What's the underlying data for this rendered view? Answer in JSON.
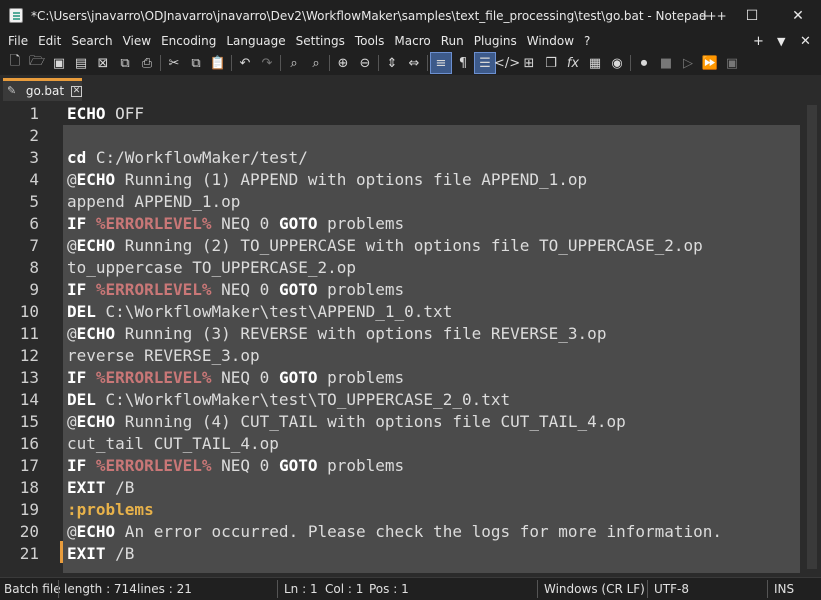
{
  "window": {
    "title": "*C:\\Users\\jnavarro\\ODJnavarro\\jnavarro\\Dev2\\WorkflowMaker\\samples\\text_file_processing\\test\\go.bat - Notepad++",
    "minimize": "—",
    "maximize": "☐",
    "close": "✕"
  },
  "menu": {
    "items": [
      "File",
      "Edit",
      "Search",
      "View",
      "Encoding",
      "Language",
      "Settings",
      "Tools",
      "Macro",
      "Run",
      "Plugins",
      "Window",
      "?"
    ],
    "right_plus": "+",
    "right_down": "▼",
    "right_close": "✕"
  },
  "toolbar": {
    "icons": [
      "new-file-icon",
      "open-file-icon",
      "save-icon",
      "save-all-icon",
      "close-icon",
      "close-all-icon",
      "print-icon",
      "cut-icon",
      "copy-icon",
      "paste-icon",
      "undo-icon",
      "redo-icon",
      "find-icon",
      "replace-icon",
      "zoom-in-icon",
      "zoom-out-icon",
      "sync-vertical-icon",
      "sync-horizontal-icon",
      "word-wrap-icon",
      "all-chars-icon",
      "indent-guide-icon",
      "lang-udl-icon",
      "doc-map-icon",
      "doc-list-icon",
      "function-list-icon",
      "folder-workspace-icon",
      "monitoring-icon",
      "record-macro-icon",
      "stop-macro-icon",
      "play-macro-icon",
      "run-macro-multiple-icon",
      "save-macro-icon"
    ]
  },
  "tab": {
    "label": "go.bat",
    "close": "✕"
  },
  "editor": {
    "line_numbers": [
      "1",
      "2",
      "3",
      "4",
      "5",
      "6",
      "7",
      "8",
      "9",
      "10",
      "11",
      "12",
      "13",
      "14",
      "15",
      "16",
      "17",
      "18",
      "19",
      "20",
      "21"
    ],
    "lines": [
      [
        {
          "t": "ECHO",
          "c": "kw"
        },
        {
          "t": " OFF",
          "c": ""
        }
      ],
      [],
      [
        {
          "t": "cd",
          "c": "kw"
        },
        {
          "t": " C:/WorkflowMaker/test/",
          "c": ""
        }
      ],
      [
        {
          "t": "@",
          "c": ""
        },
        {
          "t": "ECHO",
          "c": "kw"
        },
        {
          "t": " Running (1) APPEND with options file APPEND_1.op",
          "c": ""
        }
      ],
      [
        {
          "t": "append APPEND_1.op",
          "c": ""
        }
      ],
      [
        {
          "t": "IF",
          "c": "kw"
        },
        {
          "t": " ",
          "c": ""
        },
        {
          "t": "%ERRORLEVEL%",
          "c": "var"
        },
        {
          "t": " NEQ 0 ",
          "c": ""
        },
        {
          "t": "GOTO",
          "c": "kw"
        },
        {
          "t": " problems",
          "c": ""
        }
      ],
      [
        {
          "t": "@",
          "c": ""
        },
        {
          "t": "ECHO",
          "c": "kw"
        },
        {
          "t": " Running (2) TO_UPPERCASE with options file TO_UPPERCASE_2.op",
          "c": ""
        }
      ],
      [
        {
          "t": "to_uppercase TO_UPPERCASE_2.op",
          "c": ""
        }
      ],
      [
        {
          "t": "IF",
          "c": "kw"
        },
        {
          "t": " ",
          "c": ""
        },
        {
          "t": "%ERRORLEVEL%",
          "c": "var"
        },
        {
          "t": " NEQ 0 ",
          "c": ""
        },
        {
          "t": "GOTO",
          "c": "kw"
        },
        {
          "t": " problems",
          "c": ""
        }
      ],
      [
        {
          "t": "DEL",
          "c": "kw"
        },
        {
          "t": " C:\\WorkflowMaker\\test\\APPEND_1_0.txt",
          "c": ""
        }
      ],
      [
        {
          "t": "@",
          "c": ""
        },
        {
          "t": "ECHO",
          "c": "kw"
        },
        {
          "t": " Running (3) REVERSE with options file REVERSE_3.op",
          "c": ""
        }
      ],
      [
        {
          "t": "reverse REVERSE_3.op",
          "c": ""
        }
      ],
      [
        {
          "t": "IF",
          "c": "kw"
        },
        {
          "t": " ",
          "c": ""
        },
        {
          "t": "%ERRORLEVEL%",
          "c": "var"
        },
        {
          "t": " NEQ 0 ",
          "c": ""
        },
        {
          "t": "GOTO",
          "c": "kw"
        },
        {
          "t": " problems",
          "c": ""
        }
      ],
      [
        {
          "t": "DEL",
          "c": "kw"
        },
        {
          "t": " C:\\WorkflowMaker\\test\\TO_UPPERCASE_2_0.txt",
          "c": ""
        }
      ],
      [
        {
          "t": "@",
          "c": ""
        },
        {
          "t": "ECHO",
          "c": "kw"
        },
        {
          "t": " Running (4) CUT_TAIL with options file CUT_TAIL_4.op",
          "c": ""
        }
      ],
      [
        {
          "t": "cut_tail CUT_TAIL_4.op",
          "c": ""
        }
      ],
      [
        {
          "t": "IF",
          "c": "kw"
        },
        {
          "t": " ",
          "c": ""
        },
        {
          "t": "%ERRORLEVEL%",
          "c": "var"
        },
        {
          "t": " NEQ 0 ",
          "c": ""
        },
        {
          "t": "GOTO",
          "c": "kw"
        },
        {
          "t": " problems",
          "c": ""
        }
      ],
      [
        {
          "t": "EXIT",
          "c": "kw"
        },
        {
          "t": " /B",
          "c": ""
        }
      ],
      [
        {
          "t": ":problems",
          "c": "lbl"
        }
      ],
      [
        {
          "t": "@",
          "c": ""
        },
        {
          "t": "ECHO",
          "c": "kw"
        },
        {
          "t": " An error occurred. Please check the logs for more information.",
          "c": ""
        }
      ],
      [
        {
          "t": "EXIT",
          "c": "kw"
        },
        {
          "t": " /B",
          "c": ""
        }
      ]
    ]
  },
  "status": {
    "file_type": "Batch file",
    "length": "length : 714",
    "lines": "lines : 21",
    "ln": "Ln : 1",
    "col": "Col : 1",
    "pos": "Pos : 1",
    "eol": "Windows (CR LF)",
    "encoding": "UTF-8",
    "mode": "INS"
  },
  "colors": {
    "background": "#2b2b2b",
    "selection": "#4b4b4b",
    "tab_accent": "#e89c3c",
    "label": "#e8b24a",
    "variable": "#c97777"
  }
}
